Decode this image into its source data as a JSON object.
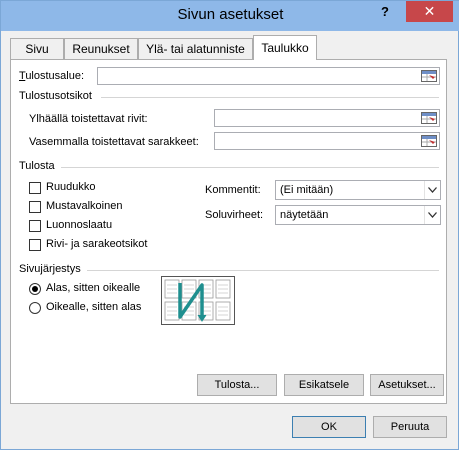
{
  "window": {
    "title": "Sivun asetukset",
    "help_label": "?",
    "close_label": "✕"
  },
  "tabs": [
    {
      "label": "Sivu"
    },
    {
      "label": "Reunukset"
    },
    {
      "label": "Ylä- tai alatunniste"
    },
    {
      "label": "Taulukko",
      "active": true
    }
  ],
  "print_area": {
    "label": "Tulostusalue:",
    "value": ""
  },
  "print_titles": {
    "section": "Tulostusotsikot",
    "rows_label": "Ylhäällä toistettavat rivit:",
    "rows_value": "",
    "cols_label": "Vasemmalla toistettavat sarakkeet:",
    "cols_value": ""
  },
  "print": {
    "section": "Tulosta",
    "checkboxes": [
      {
        "label": "Ruudukko",
        "checked": false
      },
      {
        "label": "Mustavalkoinen",
        "checked": false
      },
      {
        "label": "Luonnoslaatu",
        "checked": false
      },
      {
        "label": "Rivi- ja sarakeotsikot",
        "checked": false
      }
    ],
    "comments_label": "Kommentit:",
    "comments_value": "(Ei mitään)",
    "errors_label": "Soluvirheet:",
    "errors_value": "näytetään"
  },
  "page_order": {
    "section": "Sivujärjestys",
    "options": [
      {
        "label": "Alas, sitten oikealle",
        "selected": true
      },
      {
        "label": "Oikealle, sitten alas",
        "selected": false
      }
    ]
  },
  "actions": {
    "print": "Tulosta...",
    "preview": "Esikatsele",
    "options": "Asetukset..."
  },
  "footer": {
    "ok": "OK",
    "cancel": "Peruuta"
  },
  "colors": {
    "titlebar": "#8eb8e8",
    "close": "#c7474a",
    "accent_arrow": "#1f8f8f"
  },
  "icons": {
    "range_select": "range-select-icon",
    "dropdown": "chevron-down-icon"
  }
}
